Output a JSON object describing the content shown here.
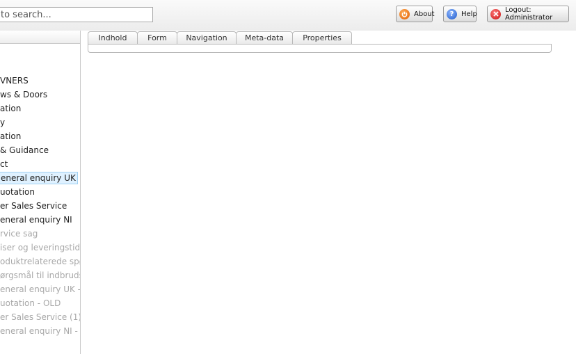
{
  "search": {
    "placeholder": "to search..."
  },
  "header": {
    "about_label": "About",
    "help_label": "Help",
    "logout_label": "Logout: Administrator"
  },
  "tree": {
    "items": [
      {
        "label": "VNERS",
        "state": "normal"
      },
      {
        "label": "ws & Doors",
        "state": "normal"
      },
      {
        "label": "ation",
        "state": "normal"
      },
      {
        "label": "y",
        "state": "normal"
      },
      {
        "label": "ation",
        "state": "normal"
      },
      {
        "label": "& Guidance",
        "state": "normal"
      },
      {
        "label": "ct",
        "state": "normal"
      },
      {
        "label": "eneral enquiry UK",
        "state": "selected"
      },
      {
        "label": "uotation",
        "state": "normal"
      },
      {
        "label": "er Sales Service",
        "state": "normal"
      },
      {
        "label": "eneral enquiry NI",
        "state": "normal"
      },
      {
        "label": "rvice sag",
        "state": "dim"
      },
      {
        "label": "iser og leveringstid",
        "state": "dim"
      },
      {
        "label": "oduktrelaterede spørgs",
        "state": "dim"
      },
      {
        "label": "ørgsmål til indbrudss",
        "state": "dim"
      },
      {
        "label": "eneral enquiry UK - OL",
        "state": "dim"
      },
      {
        "label": "uotation - OLD",
        "state": "dim"
      },
      {
        "label": "er Sales Service (1)",
        "state": "dim"
      },
      {
        "label": "eneral enquiry NI - OL",
        "state": "dim"
      }
    ]
  },
  "tabs": [
    {
      "label": "Indhold"
    },
    {
      "label": "Form"
    },
    {
      "label": "Navigation"
    },
    {
      "label": "Meta-data"
    },
    {
      "label": "Properties"
    }
  ],
  "icons": {
    "about": "power-icon",
    "help": "question-icon",
    "logout": "close-icon"
  },
  "colors": {
    "about_accent": "#e96a00",
    "help_accent": "#2a62d6",
    "logout_accent": "#d11616",
    "selected_bg": "#dff1ff",
    "dim_text": "#a8a8a8"
  }
}
